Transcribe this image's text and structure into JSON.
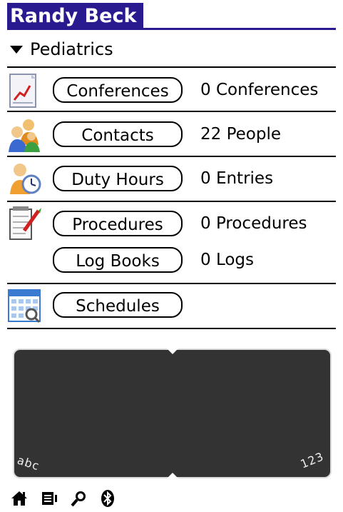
{
  "header": {
    "title": "Randy Beck"
  },
  "category": {
    "label": "Pediatrics"
  },
  "rows": [
    {
      "button": "Conferences",
      "count": "0 Conferences",
      "icon": "conferences-chart-icon"
    },
    {
      "button": "Contacts",
      "count": "22 People",
      "icon": "contacts-people-icon"
    },
    {
      "button": "Duty Hours",
      "count": "0 Entries",
      "icon": "duty-hours-clock-icon"
    },
    {
      "button": "Procedures",
      "count": "0 Procedures",
      "icon": "procedures-notepad-icon"
    },
    {
      "button": "Log Books",
      "count": "0 Logs"
    },
    {
      "button": "Schedules",
      "count": "",
      "icon": "schedules-calendar-icon"
    }
  ],
  "graffiti": {
    "left_label": "abc",
    "right_label": "123"
  },
  "colors": {
    "title_bg": "#2a1a90",
    "writing_area": "#333333"
  },
  "system_icons": [
    "home-icon",
    "menu-icon",
    "find-icon",
    "bluetooth-icon"
  ]
}
